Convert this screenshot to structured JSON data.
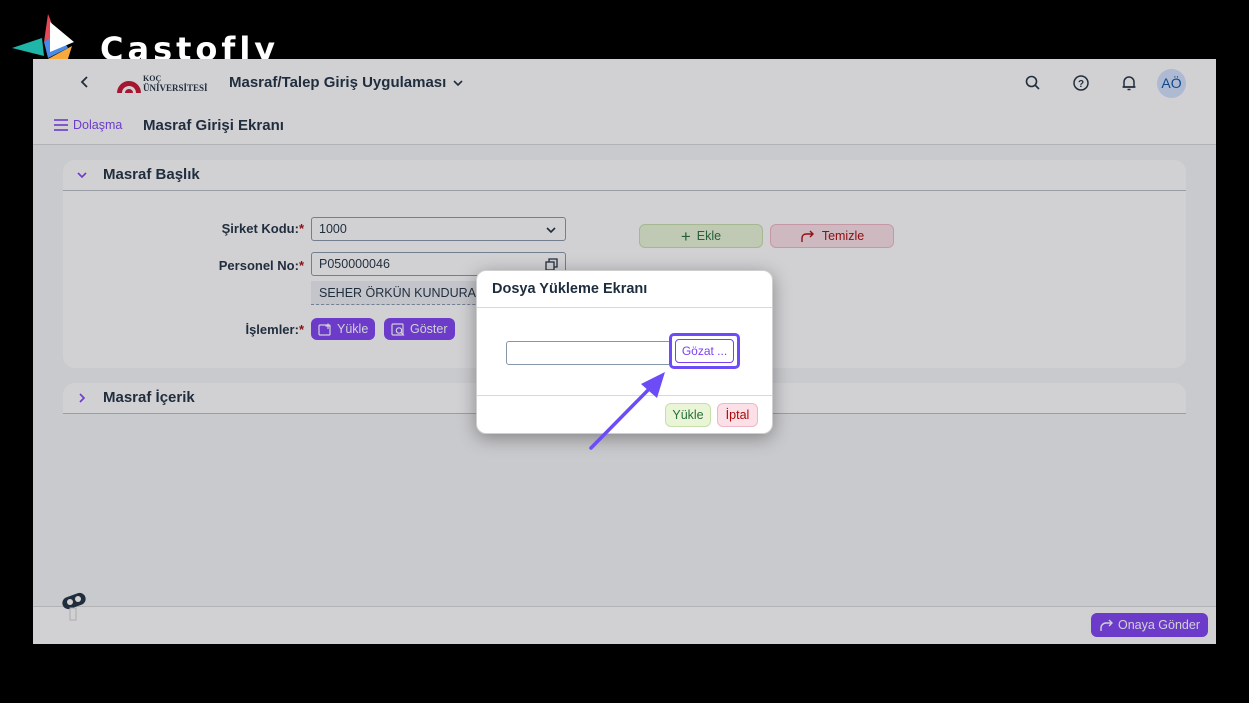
{
  "watermark": {
    "brand": "Castofly"
  },
  "shell": {
    "logo_text_top": "KOÇ",
    "logo_text_bottom": "ÜNİVERSİTESİ",
    "app_title": "Masraf/Talep Giriş Uygulaması",
    "avatar_initials": "AÖ"
  },
  "subheader": {
    "nav_label": "Dolaşma",
    "page_title": "Masraf Girişi Ekranı"
  },
  "header_panel": {
    "title": "Masraf Başlık",
    "company_code_label": "Şirket Kodu:",
    "company_code_value": "1000",
    "personnel_label": "Personel No:",
    "personnel_value": "P050000046",
    "personnel_name": "SEHER ÖRKÜN KUNDURAC",
    "actions_label": "İşlemler:",
    "upload_button": "Yükle",
    "show_button": "Göster",
    "add_button": "Ekle",
    "clear_button": "Temizle",
    "required_mark": "*"
  },
  "content_panel": {
    "title": "Masraf İçerik"
  },
  "dialog": {
    "title": "Dosya Yükleme Ekranı",
    "file_value": "",
    "browse_button": "Gözat ...",
    "upload_button": "Yükle",
    "cancel_button": "İptal"
  },
  "footer": {
    "submit_button": "Onaya Gönder"
  },
  "colors": {
    "accent": "#7e3ff2",
    "positive": "#e9f5d6",
    "negative": "#fbe0e7",
    "highlight": "#6b4cf6"
  }
}
